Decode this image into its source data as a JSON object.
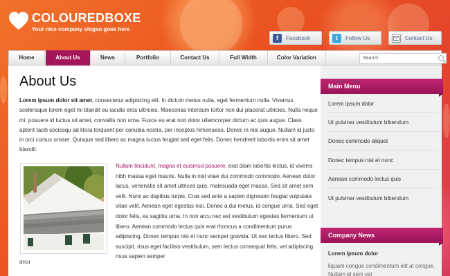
{
  "header": {
    "logo_text": "COLOUREDBOXE",
    "slogan": "Your nice company slogan goes here",
    "social": [
      {
        "label": "Facebook",
        "icon": "facebook-icon",
        "color": "#3b5998"
      },
      {
        "label": "Follow Us",
        "icon": "twitter-icon",
        "color": "#3aa9e0"
      },
      {
        "label": "Contact Us",
        "icon": "mail-icon",
        "color": "#9a9a9a"
      }
    ]
  },
  "nav": {
    "items": [
      {
        "label": "Home"
      },
      {
        "label": "About Us"
      },
      {
        "label": "News"
      },
      {
        "label": "Portfolio"
      },
      {
        "label": "Contact Us"
      },
      {
        "label": "Full Width"
      },
      {
        "label": "Color Variation"
      }
    ],
    "active": "About Us",
    "search_placeholder": "Search"
  },
  "main": {
    "title": "About Us",
    "intro_bold": "Lorem ipsum dolor sit amet",
    "intro_text": ", consectetur adipiscing elit. In dictum metus nulla, eget fermentum nulla. Vivamus scelerisque lorem eget mi blandit eu iaculis eros ultricies. Maecenas interdum tortor non dui placerat ultricies. Nulla neque mi, posuere id luctus sit amet, convallis non urna. Fusce eu erat non dolor ullamcorper dictum ac quis augue. Class aptent taciti sociosqu ad litora torquent per conubia nostra, per inceptos himenaeos. Donec in nisl augue. Nullam id justo in orci cursus ornare. Quisque sed libero ac magna luctus feugiat sed eget felis. Donec hendrerit lobortis enim sit amet blandit.",
    "para2_highlight": "Nullam tincidunt, magna et euismod posuere",
    "para2_text": ", erat diam lobortis lectus, id viverra nibh massa eget mauris. Nulla in nisl vitae dui commodo commodo. Aenean dolor lacus, venenatis sit amet ultrices quis, malesuada eget massa. Sed sit amet sem velit. Nunc ac dapibus turpis. Cras sed ante a sapien dignissim feugiat vulputate vitae velit. Aenean eget egestas nisi. Donec a dui metus, id congue urna. Sed eget dolor felis, eu sagittis urna. In non arcu nec est vestibulum egestas fermentum ut libero. Aenean commodo lectus quis erat rhoncus a condimentum purus adipiscing. Donec tempus nisi et nunc semper gravida. Ut nec lectus libero. Sed suscipit, risus eget facilisis vestibulum, sem lectus consequat felis, vel adipiscing risus sapien semper",
    "para2_tail": "arcu"
  },
  "sidebar": {
    "menu_title": "Main Menu",
    "menu_items": [
      "Lorem ipsum dolor",
      "Ut pulvinar vestibulum bibendum",
      "Donec commodo aliquet",
      "Donec tempus nisi et nunc",
      "Aenean commodo lectus quis",
      "Ut pulvinar vestibulum bibendum"
    ],
    "news_title": "Company News",
    "news_item_title": "Lorem ipsum dolor",
    "news_item_text": "liquam congue condimentum elit at congue. Nullam id sem vel"
  },
  "colors": {
    "accent": "#a3165a",
    "background": "#e85a1f"
  }
}
